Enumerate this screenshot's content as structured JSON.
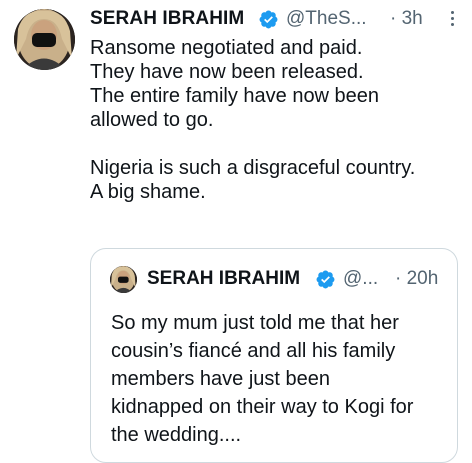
{
  "tweet": {
    "author_name": "SERAH IBRAHIM",
    "handle": "@TheS...",
    "time": "· 3h",
    "verified_icon": "verified-badge-icon",
    "more_icon": "more-options-icon",
    "text_lines": [
      "Ransome negotiated and paid.",
      "They have now been released.",
      "The entire family have now been",
      "allowed to go.",
      "",
      "Nigeria is such a disgraceful country.",
      "A big shame."
    ]
  },
  "quoted_tweet": {
    "author_name": "SERAH IBRAHIM",
    "handle": "@...",
    "time": "· 20h",
    "verified_icon": "verified-badge-icon",
    "text_lines": [
      "So my mum just told me that her",
      "cousin’s fiancé and all his family",
      "members have just been",
      "kidnapped on their way to Kogi for",
      "the wedding...."
    ]
  },
  "colors": {
    "primary_text": "#0f1419",
    "secondary_text": "#536471",
    "verified_blue": "#1d9bf0",
    "border": "#cfd9de"
  }
}
